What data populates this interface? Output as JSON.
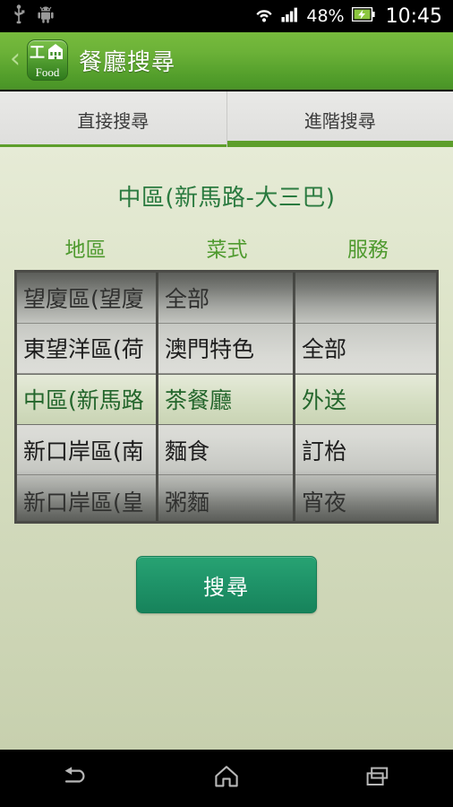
{
  "statusbar": {
    "usb_icon": "usb-icon",
    "android_icon": "android-icon",
    "wifi_icon": "wifi-icon",
    "signal_icon": "signal-bars-icon",
    "battery_percent": "48%",
    "battery_icon": "battery-charging-icon",
    "time": "10:45"
  },
  "appbar": {
    "back_label": "‹",
    "app_icon": {
      "top_char": "工",
      "building_icon": "building-icon",
      "bottom_text": "Food"
    },
    "title": "餐廳搜尋"
  },
  "tabs": [
    {
      "label": "直接搜尋",
      "active": false
    },
    {
      "label": "進階搜尋",
      "active": true
    }
  ],
  "content": {
    "heading": "中區(新馬路-大三巴)",
    "column_headers": [
      "地區",
      "菜式",
      "服務"
    ],
    "picker": {
      "columns": [
        {
          "name": "district",
          "header": "地區",
          "selected_index": 2,
          "items": [
            "望廈區(望廈",
            "東望洋區(荷",
            "中區(新馬路",
            "新口岸區(南",
            "新口岸區(皇"
          ]
        },
        {
          "name": "cuisine",
          "header": "菜式",
          "selected_index": 2,
          "items": [
            "全部",
            "澳門特色",
            "茶餐廳",
            "麵食",
            "粥麵"
          ]
        },
        {
          "name": "service",
          "header": "服務",
          "selected_index": 2,
          "items": [
            "",
            "全部",
            "外送",
            "訂枱",
            "宵夜"
          ]
        }
      ]
    },
    "search_button": "搜尋"
  },
  "navbar": {
    "back_icon": "back-arrow-icon",
    "home_icon": "home-icon",
    "recents_icon": "recents-icon"
  },
  "colors": {
    "appbar_green": "#6cb238",
    "tab_accent": "#5d9e2b",
    "heading_green": "#2a7a3f",
    "column_header_green": "#4f9a2f",
    "selected_text_green": "#24662c",
    "search_button_green": "#1f9469",
    "content_bg_top": "#e6ebd6",
    "content_bg_bottom": "#c7d0ae"
  }
}
